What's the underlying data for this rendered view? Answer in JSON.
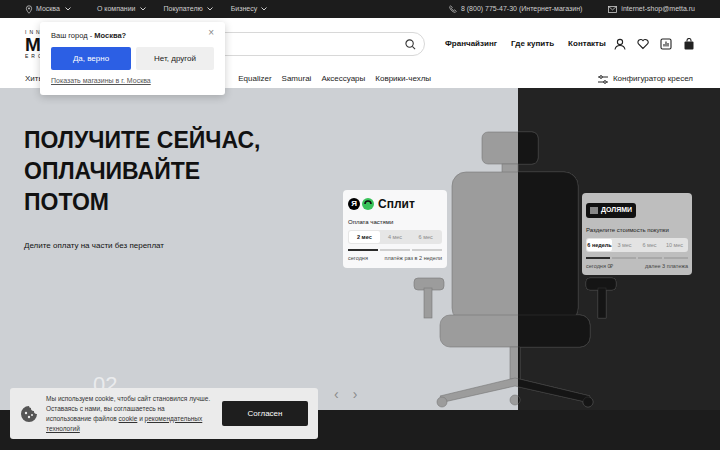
{
  "topbar": {
    "city": "Москва",
    "menu": [
      "О компании",
      "Покупателю",
      "Бизнесу"
    ],
    "phone": "8 (800) 775-47-30 (Интернет-магазин)",
    "email": "internet-shop@metta.ru"
  },
  "logo": {
    "top": "INN",
    "main": "M",
    "bottom": "ERG"
  },
  "header_links": [
    "Франчайзинг",
    "Где купить",
    "Контакты"
  ],
  "nav": {
    "items": [
      "Хиты",
      "Equalizer",
      "Samurai",
      "Аксессуары",
      "Коврики-чехлы"
    ],
    "configurator": "Конфигуратор кресел"
  },
  "hero": {
    "title_lines": [
      "ПОЛУЧИТЕ СЕЙЧАС,",
      "ОПЛАЧИВАЙТЕ",
      "ПОТОМ"
    ],
    "subtitle": "Делите оплату на части без переплат",
    "slide": "02",
    "prev": "‹",
    "next": "›"
  },
  "split_card": {
    "brand_mark": "Я",
    "name": "Сплит",
    "caption": "Оплата частями",
    "options": [
      {
        "label": "2 мес",
        "selected": true
      },
      {
        "label": "4 мес",
        "selected": false
      },
      {
        "label": "6 мес",
        "selected": false
      }
    ],
    "today": "сегодня",
    "schedule": "платёж раз в 2 недели"
  },
  "dolyami_card": {
    "brand": "ДОЛЯМИ",
    "caption": "Разделите стоимость покупки",
    "options": [
      {
        "label": "6 недель",
        "selected": true
      },
      {
        "label": "3 мес",
        "selected": false
      },
      {
        "label": "6 мес",
        "selected": false
      },
      {
        "label": "10 мес",
        "selected": false
      }
    ],
    "today": "сегодня 0₽",
    "schedule": "далее 3 платежа"
  },
  "city_popup": {
    "prefix": "Ваш город - ",
    "city": "Москва?",
    "close": "×",
    "confirm": "Да, верно",
    "decline": "Нет, другой",
    "stores_link": "Показать магазины в г. Москва"
  },
  "cookie": {
    "text": "Мы используем cookie, чтобы сайт становился лучше. Оставаясь с нами, вы соглашаетесь на использование файлов ",
    "link1": "cookie",
    "and": " и ",
    "link2": "рекомендательных технологий",
    "button": "Согласен"
  }
}
